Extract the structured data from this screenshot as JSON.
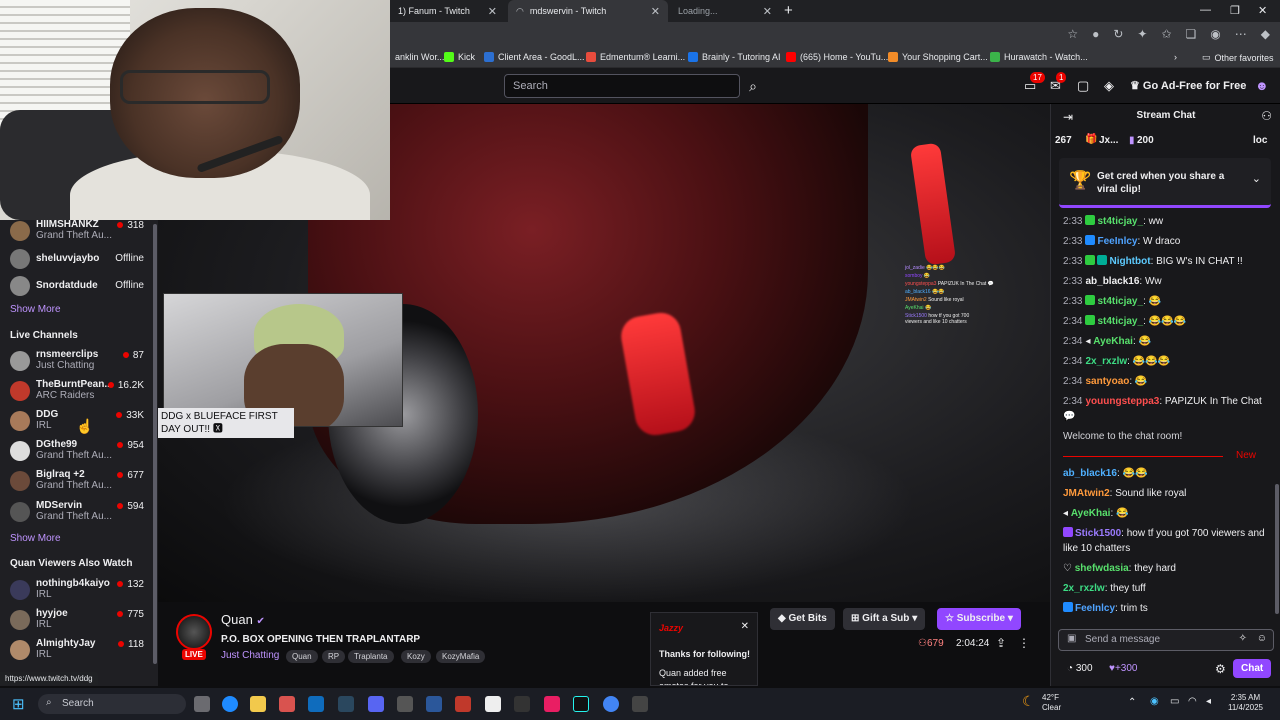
{
  "browser": {
    "tabs": [
      {
        "title": "1) Fanum - Twitch"
      },
      {
        "title": "mdswervin - Twitch"
      },
      {
        "title": "Loading..."
      }
    ],
    "new_tab": "+",
    "bookmarks": [
      {
        "label": "anklin Wor...",
        "color": "#4b6cb7"
      },
      {
        "label": "Kick",
        "color": "#53fc18"
      },
      {
        "label": "Client Area - GoodL...",
        "color": "#2c6fd1"
      },
      {
        "label": "Edmentum® Learni...",
        "color": "#e84c3d"
      },
      {
        "label": "Brainly - Tutoring AI",
        "color": "#1a73e8"
      },
      {
        "label": "(665) Home - YouTu...",
        "color": "#ff0000"
      },
      {
        "label": "Your Shopping Cart...",
        "color": "#f28c28"
      },
      {
        "label": "Hurawatch - Watch...",
        "color": "#3bb44a"
      }
    ],
    "other_favorites": "Other favorites",
    "status_url": "https://www.twitch.tv/ddg"
  },
  "twitch_top": {
    "search_placeholder": "Search",
    "inbox_count": "17",
    "notif_count": "1",
    "ad_free": "Go Ad-Free for Free"
  },
  "sidebar": {
    "followed": [
      {
        "name": "HIIMSHANKZ",
        "game": "Grand Theft Au...",
        "viewers": "318",
        "live": true,
        "color": "#8a6a4a"
      },
      {
        "name": "sheluvvjaybo",
        "status": "Offline",
        "live": false,
        "color": "#777"
      },
      {
        "name": "Snordatdude",
        "status": "Offline",
        "live": false,
        "color": "#888"
      }
    ],
    "show_more_1": "Show More",
    "live_header": "Live Channels",
    "live": [
      {
        "name": "rnsmeerclips",
        "game": "Just Chatting",
        "viewers": "87",
        "color": "#999"
      },
      {
        "name": "TheBurntPean...",
        "game": "ARC Raiders",
        "viewers": "16.2K",
        "color": "#c0392b"
      },
      {
        "name": "DDG",
        "game": "IRL",
        "viewers": "33K",
        "color": "#a87a5a"
      },
      {
        "name": "DGthe99",
        "game": "Grand Theft Au...",
        "viewers": "954",
        "color": "#ddd"
      },
      {
        "name": "Biglraq +2",
        "game": "Grand Theft Au...",
        "viewers": "677",
        "color": "#6b4a3a"
      },
      {
        "name": "MDServin",
        "game": "Grand Theft Au...",
        "viewers": "594",
        "color": "#555"
      }
    ],
    "show_more_2": "Show More",
    "also_watch_header": "Quan Viewers Also Watch",
    "also_watch": [
      {
        "name": "nothingb4kaiyo",
        "game": "IRL",
        "viewers": "132",
        "color": "#3a3a5a"
      },
      {
        "name": "hyyjoe",
        "game": "IRL",
        "viewers": "775",
        "color": "#7a6a5a"
      },
      {
        "name": "AlmightyJay",
        "game": "IRL",
        "viewers": "118",
        "color": "#b08a6a"
      }
    ]
  },
  "video": {
    "tooltip": "DDG x BLUEFACE FIRST DAY OUT!! 🆇",
    "overlay_chat": [
      {
        "user": "jol_zadie",
        "text": "😂😂😂",
        "color": "#b58cff"
      },
      {
        "user": "somboy",
        "text": "😂",
        "color": "#9147ff"
      },
      {
        "user": "youngsteppa3",
        "text": "PAPIZUK In The Chat 💬",
        "color": "#ff4f4f"
      },
      {
        "user": "ab_black16",
        "text": "😂😂",
        "color": "#4fb0ff"
      },
      {
        "user": "JMAtwin2",
        "text": "Sound like royal",
        "color": "#ff9a3c"
      },
      {
        "user": "AyeKhai",
        "text": "😂",
        "color": "#58e06c"
      },
      {
        "user": "Stick1500",
        "text": "how tf you got 700 viewers and like 10 chatters",
        "color": "#9b7bff"
      }
    ]
  },
  "stream_info": {
    "streamer": "Quan",
    "title": "P.O. BOX OPENING THEN TRAPLANTARP",
    "category": "Just Chatting",
    "live_label": "LIVE",
    "tags": [
      "Quan",
      "RP",
      "Traplanta",
      "Kozy",
      "KozyMafia"
    ],
    "viewers": "679",
    "uptime": "2:04:24",
    "get_bits": "Get Bits",
    "gift_sub": "Gift a Sub",
    "subscribe": "Subscribe"
  },
  "toast": {
    "brand": "Jazzy",
    "title": "Thanks for following!",
    "body": "Quan added free emotes for you to"
  },
  "chat": {
    "header": "Stream Chat",
    "hype_count": "267",
    "hype_user": "Jx...",
    "hype_bits": "200",
    "hype_right": "loc",
    "clip_banner": "Get cred when you share a viral clip!",
    "messages": [
      {
        "time": "2:33",
        "user": "st4ticjay_",
        "text": ": ww",
        "color": "#58e06c",
        "badge": "#2ecc40"
      },
      {
        "time": "2:33",
        "user": "FeeInlcy",
        "text": ": W draco",
        "color": "#4fa3ff",
        "badge": "#1f8bff"
      },
      {
        "time": "2:33",
        "user": "Nightbot",
        "text": ": BIG W's IN CHAT !!",
        "color": "#5dcbff",
        "badge": "#2ecc40"
      },
      {
        "time": "2:33",
        "user": "ab_black16",
        "text": ": Ww",
        "color": "#efeff1",
        "badge": ""
      },
      {
        "time": "2:33",
        "user": "st4ticjay_",
        "text": ": 😂",
        "color": "#58e06c",
        "badge": "#2ecc40"
      },
      {
        "time": "2:34",
        "user": "st4ticjay_",
        "text": ": 😂😂😂",
        "color": "#58e06c",
        "badge": "#2ecc40"
      },
      {
        "time": "2:34",
        "user": "AyeKhai",
        "text": ": 😂",
        "color": "#58e06c",
        "badge": "#444"
      },
      {
        "time": "2:34",
        "user": "2x_rxzlw",
        "text": ": 😂😂😂",
        "color": "#3ddc84",
        "badge": ""
      },
      {
        "time": "2:34",
        "user": "santyoao",
        "text": ": 😂",
        "color": "#ff9a3c",
        "badge": ""
      },
      {
        "time": "2:34",
        "user": "youungsteppa3",
        "text": ": PAPIZUK In The Chat 💬",
        "color": "#ff4f4f",
        "badge": ""
      }
    ],
    "welcome": "Welcome to the chat room!",
    "new_label": "New",
    "new_messages": [
      {
        "user": "ab_black16",
        "text": ": 😂😂",
        "color": "#4fb0ff",
        "badge": ""
      },
      {
        "user": "JMAtwin2",
        "text": ": Sound like royal",
        "color": "#ff9a3c",
        "badge": ""
      },
      {
        "user": "AyeKhai",
        "text": ": 😂",
        "color": "#58e06c",
        "badge": "#444"
      },
      {
        "user": "Stick1500",
        "text": ": how tf you got 700 viewers and like 10 chatters",
        "color": "#9b7bff",
        "badge": "#9147ff"
      },
      {
        "user": "shefwdasia",
        "text": ": they hard",
        "color": "#58e06c",
        "badge": "#444"
      },
      {
        "user": "2x_rxzlw",
        "text": ": they tuff",
        "color": "#3ddc84",
        "badge": ""
      },
      {
        "user": "FeeInlcy",
        "text": ": trim ts",
        "color": "#4fa3ff",
        "badge": "#1f8bff"
      }
    ],
    "input_placeholder": "Send a message",
    "points": "300",
    "points_bonus": "+300",
    "chat_button": "Chat"
  },
  "taskbar": {
    "search": "Search",
    "weather_temp": "42°F",
    "weather_desc": "Clear",
    "time": "2:35 AM",
    "date": "11/4/2025"
  }
}
